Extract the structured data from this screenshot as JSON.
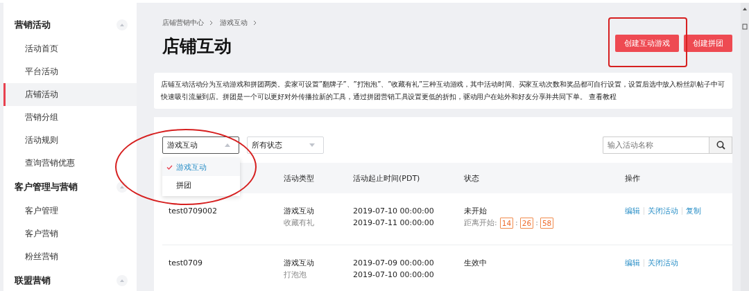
{
  "sidebar": {
    "groups": [
      {
        "title": "营销活动",
        "expanded": true,
        "items": [
          {
            "label": "活动首页",
            "selected": false
          },
          {
            "label": "平台活动",
            "selected": false
          },
          {
            "label": "店铺活动",
            "selected": true
          },
          {
            "label": "营销分组",
            "selected": false
          },
          {
            "label": "活动规则",
            "selected": false
          },
          {
            "label": "查询营销优惠",
            "selected": false
          }
        ]
      },
      {
        "title": "客户管理与营销",
        "expanded": true,
        "items": [
          {
            "label": "客户管理",
            "selected": false
          },
          {
            "label": "客户营销",
            "selected": false
          },
          {
            "label": "粉丝营销",
            "selected": false
          }
        ]
      },
      {
        "title": "联盟营销",
        "expanded": true
      }
    ]
  },
  "breadcrumb": [
    "店铺营销中心",
    "游戏互动"
  ],
  "page_title": "店铺互动",
  "header_buttons": [
    "创建互动游戏",
    "创建拼团"
  ],
  "description": "店铺互动活动分为互动游戏和拼团两类。卖家可设置”翻牌子”、”打泡泡”、”收藏有礼”三种互动游戏，其中活动时间、买家互动次数和奖品都可自行设置，设置后选中放入粉丝趴帖子中可快速吸引流量到店。拼团是一个可以更好对外传播拉新的工具，通过拼团营销工具设置更低的折扣，驱动用户在站外和好友分享并共同下单。",
  "description_link": "查看教程",
  "filters": [
    {
      "value": "游戏互动",
      "expanded": true,
      "options": [
        {
          "label": "游戏互动",
          "selected": true
        },
        {
          "label": "拼团",
          "selected": false
        }
      ]
    },
    {
      "value": "所有状态",
      "expanded": false
    }
  ],
  "search": {
    "placeholder": "输入活动名称"
  },
  "table": {
    "columns": [
      "活动类型",
      "活动起止时间(PDT)",
      "状态",
      "操作"
    ],
    "rows": [
      {
        "name": "test0709002",
        "type": "游戏互动",
        "subtype": "收藏有礼",
        "start": "2019-07-10 00:00:00",
        "end": "2019-07-11 00:00:00",
        "status": "未开始",
        "countdown": {
          "label": "距离开始:",
          "parts": [
            "14",
            "26",
            "58"
          ],
          "separator": ":"
        },
        "actions": [
          "编辑",
          "关闭活动",
          "复制"
        ]
      },
      {
        "name": "test0709",
        "type": "游戏互动",
        "subtype": "打泡泡",
        "start": "2019-07-09 00:00:00",
        "end": "2019-07-10 00:00:00",
        "status": "生效中",
        "actions": [
          "编辑",
          "关闭活动"
        ]
      }
    ]
  },
  "annotations": [
    {
      "kind": "ellipse"
    },
    {
      "kind": "rectangle"
    }
  ]
}
